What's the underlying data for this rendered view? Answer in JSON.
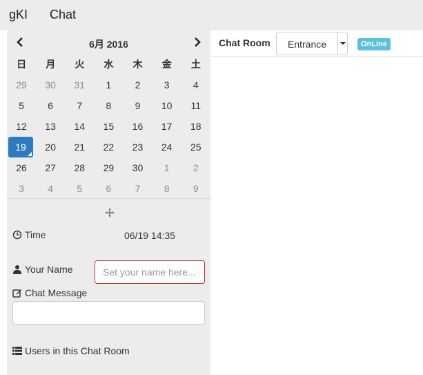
{
  "navbar": {
    "brand": "gKI",
    "link": "Chat"
  },
  "calendar": {
    "title": "6月 2016",
    "weekdays": [
      "日",
      "月",
      "火",
      "水",
      "木",
      "金",
      "土"
    ],
    "weeks": [
      [
        {
          "d": "29",
          "m": true
        },
        {
          "d": "30",
          "m": true
        },
        {
          "d": "31",
          "m": true
        },
        {
          "d": "1"
        },
        {
          "d": "2"
        },
        {
          "d": "3"
        },
        {
          "d": "4"
        }
      ],
      [
        {
          "d": "5"
        },
        {
          "d": "6"
        },
        {
          "d": "7"
        },
        {
          "d": "8"
        },
        {
          "d": "9"
        },
        {
          "d": "10"
        },
        {
          "d": "11"
        }
      ],
      [
        {
          "d": "12"
        },
        {
          "d": "13"
        },
        {
          "d": "14"
        },
        {
          "d": "15"
        },
        {
          "d": "16"
        },
        {
          "d": "17"
        },
        {
          "d": "18"
        }
      ],
      [
        {
          "d": "19",
          "selected": true
        },
        {
          "d": "20"
        },
        {
          "d": "21"
        },
        {
          "d": "22"
        },
        {
          "d": "23"
        },
        {
          "d": "24"
        },
        {
          "d": "25"
        }
      ],
      [
        {
          "d": "26"
        },
        {
          "d": "27"
        },
        {
          "d": "28"
        },
        {
          "d": "29"
        },
        {
          "d": "30"
        },
        {
          "d": "1",
          "m": true
        },
        {
          "d": "2",
          "m": true
        }
      ],
      [
        {
          "d": "3",
          "m": true
        },
        {
          "d": "4",
          "m": true
        },
        {
          "d": "5",
          "m": true
        },
        {
          "d": "6",
          "m": true
        },
        {
          "d": "7",
          "m": true
        },
        {
          "d": "8",
          "m": true
        },
        {
          "d": "9",
          "m": true
        }
      ]
    ],
    "selected_color": "#2c7bc0",
    "prev_icon": "chevron-left-icon",
    "next_icon": "chevron-right-icon"
  },
  "time": {
    "label": "Time",
    "value": "06/19 14:35",
    "icon": "clock-icon"
  },
  "name": {
    "label": "Your Name",
    "placeholder": "Set your name here...",
    "value": "",
    "icon": "user-icon"
  },
  "message": {
    "label": "Chat Message",
    "value": "",
    "icon": "edit-icon"
  },
  "users": {
    "label": "Users in this Chat Room",
    "icon": "list-icon"
  },
  "room": {
    "label": "Chat Room",
    "selected": "Entrance",
    "status": "OnLine",
    "status_color": "#5bc0de"
  }
}
